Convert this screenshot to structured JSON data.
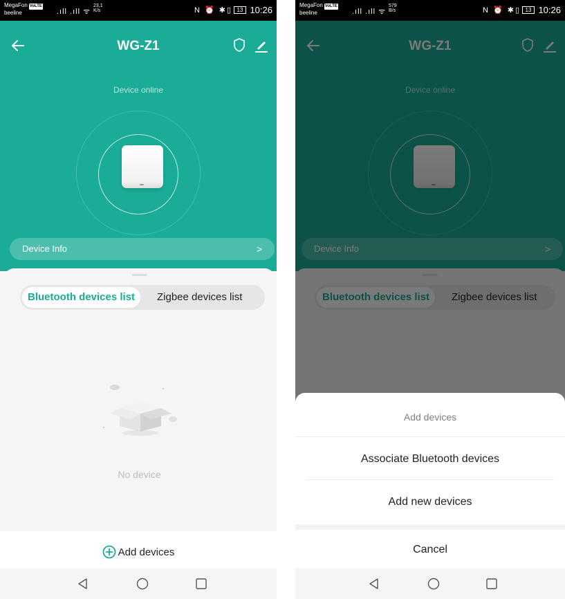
{
  "status_bar": {
    "carrier_1": "MegaFon",
    "carrier_badge": "VoLTE",
    "carrier_2": "beeline",
    "left_screen": {
      "speed_value": "23,1",
      "speed_unit": "K/s"
    },
    "right_screen": {
      "speed_value": "579",
      "speed_unit": "B/s"
    },
    "battery": "13",
    "time": "10:26"
  },
  "header": {
    "title": "WG-Z1",
    "status": "Device online",
    "device_info_label": "Device Info",
    "device_info_chevron": ">"
  },
  "tabs": {
    "active": "Bluetooth devices list",
    "inactive": "Zigbee devices list"
  },
  "empty_state": {
    "text": "No device"
  },
  "bottom_action": {
    "label": "Add devices"
  },
  "add_sheet": {
    "title": "Add devices",
    "options": [
      "Associate Bluetooth devices",
      "Add new devices"
    ],
    "cancel": "Cancel"
  },
  "colors": {
    "accent": "#1aac96",
    "accent_text": "#1aac96",
    "dim_overlay": "rgba(0,0,0,0.52)"
  },
  "icons": [
    "back-arrow-icon",
    "shield-icon",
    "edit-pencil-icon",
    "plus-circle-icon",
    "nav-back-icon",
    "nav-home-icon",
    "nav-recent-icon"
  ]
}
